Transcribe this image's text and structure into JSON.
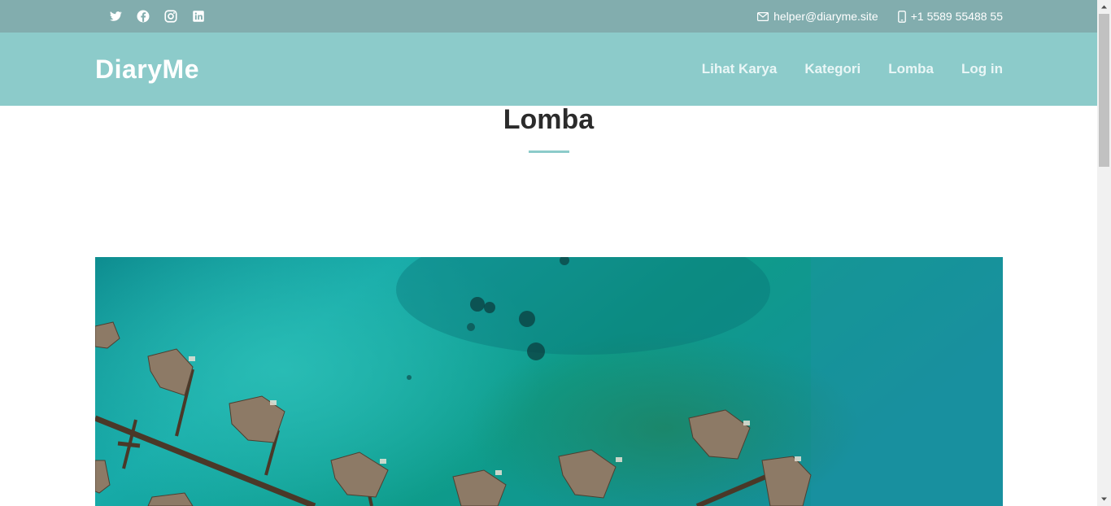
{
  "topbar": {
    "social": [
      "twitter-icon",
      "facebook-icon",
      "instagram-icon",
      "linkedin-icon"
    ],
    "email": "helper@diaryme.site",
    "phone": "+1 5589 55488 55"
  },
  "header": {
    "logo": "DiaryMe",
    "nav": [
      "Lihat Karya",
      "Kategori",
      "Lomba",
      "Log in"
    ]
  },
  "section": {
    "title": "Lomba"
  },
  "colors": {
    "topbar": "#82adae",
    "header": "#8ccbca",
    "accent": "#8ccbca",
    "title": "#2b2b2b"
  }
}
